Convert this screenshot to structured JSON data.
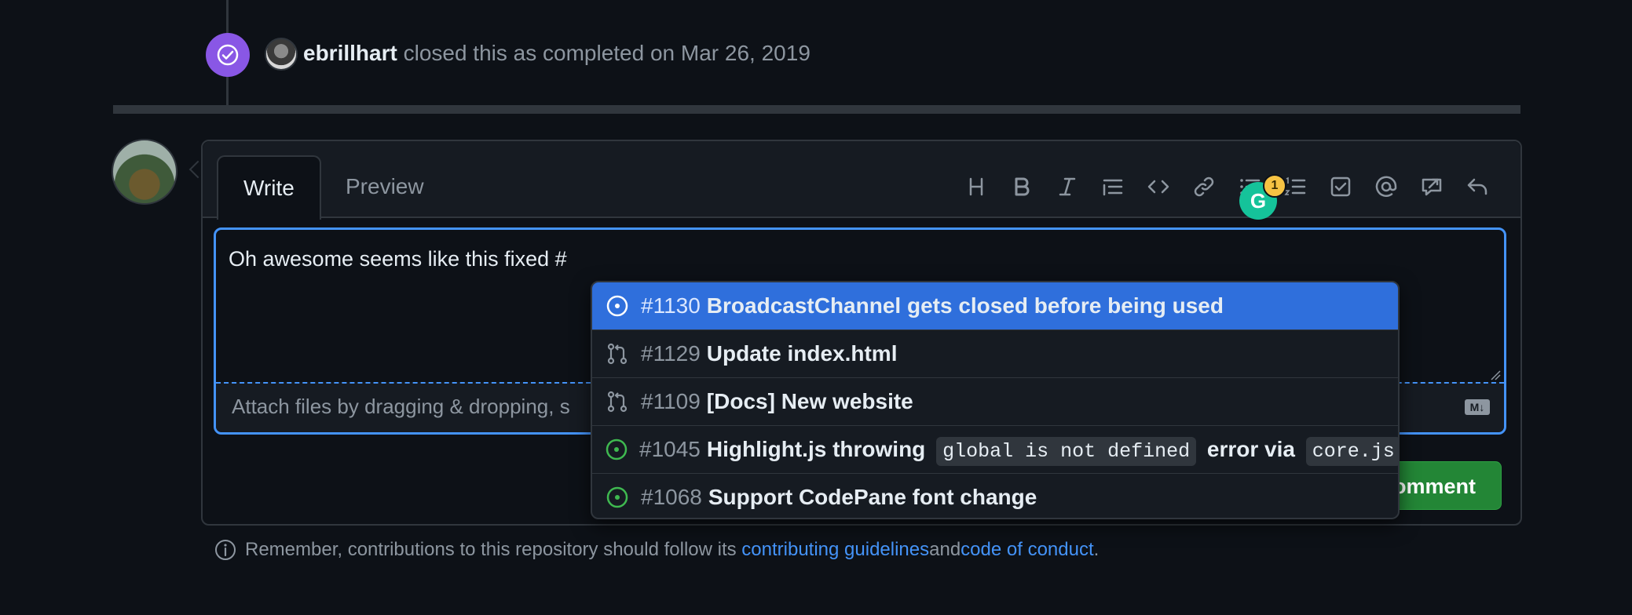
{
  "timeline_event": {
    "actor": "ebrillhart",
    "action_text": " closed this as completed on Mar 26, 2019"
  },
  "editor_tabs": {
    "write": "Write",
    "preview": "Preview"
  },
  "toolbar_icons": [
    "heading-icon",
    "bold-icon",
    "italic-icon",
    "quote-icon",
    "code-icon",
    "link-icon",
    "unordered-list-icon",
    "ordered-list-icon",
    "task-list-icon",
    "mention-icon",
    "reference-icon",
    "undo-icon"
  ],
  "editor": {
    "text": "Oh awesome seems like this fixed #",
    "attach_text": "Attach files by dragging & dropping, s",
    "markdown_badge": "M↓"
  },
  "grammarly": {
    "count": "1"
  },
  "comment_button": "omment",
  "suggestions": [
    {
      "number": "#1130",
      "title": "BroadcastChannel gets closed before being used",
      "kind": "issue-open",
      "selected": true
    },
    {
      "number": "#1129",
      "title": "Update index.html",
      "kind": "pull-request"
    },
    {
      "number": "#1109",
      "title": "[Docs] New website",
      "kind": "pull-request"
    },
    {
      "number": "#1045",
      "title_parts": [
        "Highlight.js throwing ",
        "global is not defined",
        " error via ",
        "core.js"
      ],
      "kind": "issue-open"
    },
    {
      "number": "#1068",
      "title": "Support CodePane font change",
      "kind": "issue-open"
    }
  ],
  "footer": {
    "prefix": "Remember, contributions to this repository should follow its ",
    "link1": "contributing guidelines",
    "middle": " and ",
    "link2": "code of conduct",
    "suffix": "."
  },
  "colors": {
    "background": "#0d1117",
    "accent_blue": "#4493f8",
    "selected_row": "#2f6fdc",
    "closed_badge": "#8957e5",
    "open_issue_green": "#3fb950",
    "button_green": "#238636"
  }
}
